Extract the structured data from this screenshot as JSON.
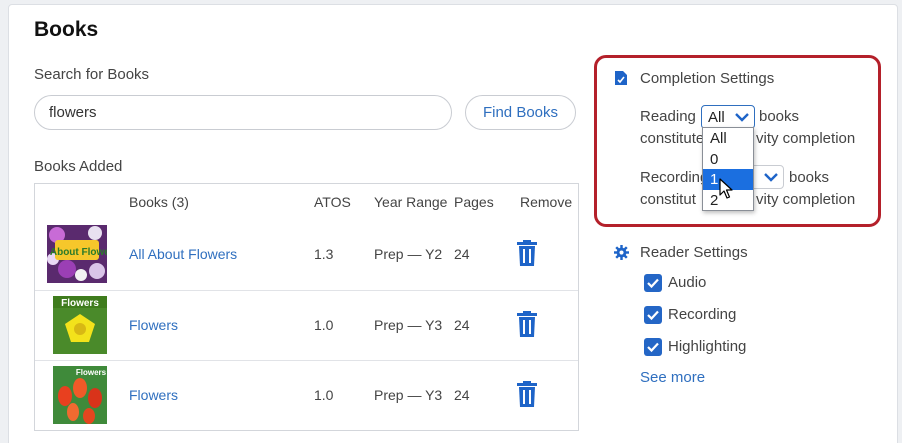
{
  "page_title": "Books",
  "search": {
    "label": "Search for Books",
    "value": "flowers",
    "button_label": "Find Books"
  },
  "books_added": {
    "label": "Books Added",
    "columns": [
      "Books (3)",
      "ATOS",
      "Year Range",
      "Pages",
      "Remove"
    ],
    "rows": [
      {
        "title": "All About Flowers",
        "atos": "1.3",
        "year_range": "Prep — Y2",
        "pages": "24",
        "cover_text": "All About Flowers"
      },
      {
        "title": "Flowers",
        "atos": "1.0",
        "year_range": "Prep — Y3",
        "pages": "24",
        "cover_text": "Flowers"
      },
      {
        "title": "Flowers",
        "atos": "1.0",
        "year_range": "Prep — Y3",
        "pages": "24",
        "cover_text": "Flowers"
      }
    ]
  },
  "completion_settings": {
    "title": "Completion Settings",
    "icon": "document-check-icon",
    "reading": {
      "prefix": "Reading",
      "selected": "All",
      "suffix_line1": "books",
      "line2_left": "constitute",
      "line2_right": "vity completion"
    },
    "recording": {
      "prefix": "Recording",
      "suffix_line1": "books",
      "line2_left": "constitut",
      "line2_right": "vity completion"
    },
    "dropdown_options": [
      "All",
      "0",
      "1",
      "2"
    ],
    "highlighted_option": "1",
    "highlight_color": "#b4202a"
  },
  "reader_settings": {
    "title": "Reader Settings",
    "icon": "gear-icon",
    "options": [
      {
        "label": "Audio",
        "checked": true
      },
      {
        "label": "Recording",
        "checked": true
      },
      {
        "label": "Highlighting",
        "checked": true
      }
    ],
    "see_more": "See more"
  },
  "colors": {
    "link": "#2f6fbf",
    "checkbox": "#2466c6",
    "accent_border": "#b4202a"
  }
}
